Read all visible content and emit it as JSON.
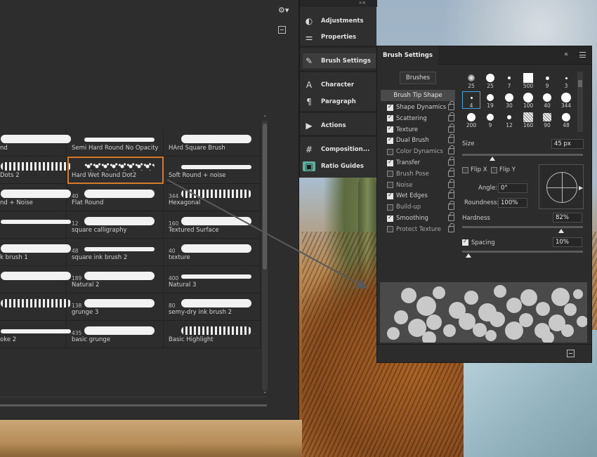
{
  "brushes_panel": {
    "gear_icon": "gear-icon",
    "new_brush_icon": "new-brush-icon",
    "cells": [
      {
        "label": "nd",
        "num": "",
        "col": 0,
        "row": 0
      },
      {
        "label": "Semi Hard Round No Opacity",
        "num": "",
        "col": 1,
        "row": 0
      },
      {
        "label": "HArd Square Brush",
        "num": "",
        "col": 2,
        "row": 0
      },
      {
        "label": "Dots 2",
        "num": "",
        "col": 0,
        "row": 1
      },
      {
        "label": "Hard Wet Round Dot2",
        "num": "",
        "col": 1,
        "row": 1,
        "selected": true
      },
      {
        "label": "Soft Round + noise",
        "num": "",
        "col": 2,
        "row": 1
      },
      {
        "label": "nd + Noise",
        "num": "",
        "col": 0,
        "row": 2
      },
      {
        "label": "Flat Round",
        "num": "40",
        "col": 1,
        "row": 2
      },
      {
        "label": "Hexagonal",
        "num": "344",
        "col": 2,
        "row": 2
      },
      {
        "label": "",
        "num": "",
        "col": 0,
        "row": 3
      },
      {
        "label": "square calligraphy",
        "num": "12",
        "col": 1,
        "row": 3
      },
      {
        "label": "Textured Surface",
        "num": "160",
        "col": 2,
        "row": 3
      },
      {
        "label": "k brush 1",
        "num": "",
        "col": 0,
        "row": 4
      },
      {
        "label": "square ink brush 2",
        "num": "48",
        "col": 1,
        "row": 4
      },
      {
        "label": "texture",
        "num": "40",
        "col": 2,
        "row": 4
      },
      {
        "label": "",
        "num": "",
        "col": 0,
        "row": 5
      },
      {
        "label": "Natural 2",
        "num": "189",
        "col": 1,
        "row": 5
      },
      {
        "label": "Natural 3",
        "num": "400",
        "col": 2,
        "row": 5
      },
      {
        "label": "",
        "num": "",
        "col": 0,
        "row": 6
      },
      {
        "label": "grunge 3",
        "num": "138",
        "col": 1,
        "row": 6
      },
      {
        "label": "semy-dry  ink brush 2",
        "num": "80",
        "col": 2,
        "row": 6
      },
      {
        "label": "oke 2",
        "num": "",
        "col": 0,
        "row": 7
      },
      {
        "label": "basic grunge",
        "num": "435",
        "col": 1,
        "row": 7
      },
      {
        "label": "Basic Highlight",
        "num": "",
        "col": 2,
        "row": 7
      }
    ]
  },
  "dock": {
    "items": [
      {
        "label": "Adjustments",
        "icon": "adjustments-icon",
        "glyph": "◐"
      },
      {
        "label": "Properties",
        "icon": "properties-icon",
        "glyph": "⚌"
      },
      {
        "label": "Brush Settings",
        "icon": "brush-icon",
        "glyph": "✎",
        "active": true
      },
      {
        "label": "Character",
        "icon": "character-icon",
        "glyph": "A"
      },
      {
        "label": "Paragraph",
        "icon": "paragraph-icon",
        "glyph": "¶"
      },
      {
        "label": "Actions",
        "icon": "actions-play-icon",
        "glyph": "▶"
      },
      {
        "label": "Composition...",
        "icon": "grid-icon",
        "glyph": "#"
      },
      {
        "label": "Ratio Guides",
        "icon": "ratio-guides-icon",
        "glyph": "▣"
      }
    ]
  },
  "brush_settings": {
    "title": "Brush Settings",
    "brushes_button": "Brushes",
    "tip_shape": "Brush Tip Shape",
    "options": [
      {
        "label": "Shape Dynamics",
        "checked": true
      },
      {
        "label": "Scattering",
        "checked": true
      },
      {
        "label": "Texture",
        "checked": true
      },
      {
        "label": "Dual Brush",
        "checked": true
      },
      {
        "label": "Color Dynamics",
        "checked": false
      },
      {
        "label": "Transfer",
        "checked": true
      },
      {
        "label": "Brush Pose",
        "checked": false
      },
      {
        "label": "Noise",
        "checked": false
      },
      {
        "label": "Wet Edges",
        "checked": true
      },
      {
        "label": "Build-up",
        "checked": false
      },
      {
        "label": "Smoothing",
        "checked": true
      },
      {
        "label": "Protect Texture",
        "checked": false
      }
    ],
    "presets": [
      [
        "25",
        "25",
        "7",
        "500",
        "9",
        "3"
      ],
      [
        "4",
        "19",
        "30",
        "100",
        "40",
        "344"
      ],
      [
        "200",
        "9",
        "12",
        "160",
        "90",
        "48"
      ]
    ],
    "size_label": "Size",
    "size_value": "45 px",
    "size_level": 0.25,
    "flip_x": "Flip X",
    "flip_y": "Flip Y",
    "angle_label": "Angle:",
    "angle_value": "0°",
    "roundness_label": "Roundness:",
    "roundness_value": "100%",
    "hardness_label": "Hardness",
    "hardness_value": "82%",
    "hardness_level": 0.82,
    "spacing_label": "Spacing",
    "spacing_value": "10%",
    "spacing_checked": true,
    "spacing_level": 0.05
  }
}
